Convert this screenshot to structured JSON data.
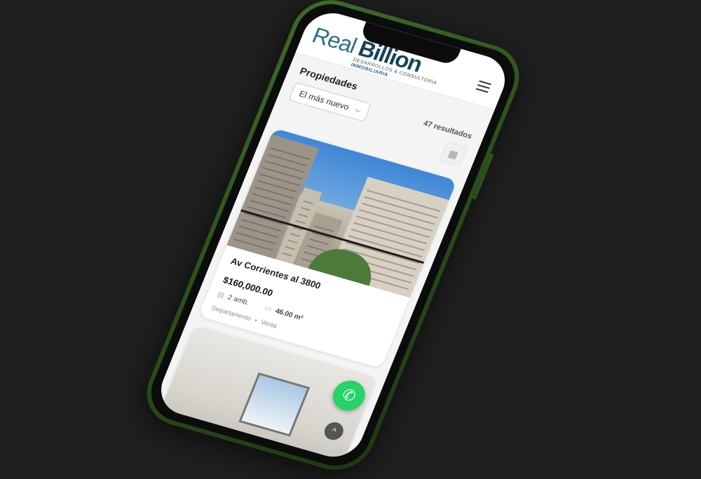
{
  "brand": {
    "name_part1": "Real",
    "name_part2": "Billion",
    "tagline": "DESARROLLOS & CONSULTORÍA",
    "tagline2": "INMOBILIARIA",
    "colors": {
      "primary": "#14425a",
      "accent": "#2a6f86",
      "frame": "#2b4f1d"
    }
  },
  "header": {
    "menu_icon": "hamburger-icon"
  },
  "list": {
    "title": "Propiedades",
    "sort_selected": "El más nuevo",
    "results": "47 resultados",
    "view_toggle_icon": "grid-icon"
  },
  "cards": [
    {
      "title": "Av Corrientes al 3800",
      "price": "$160,000.00",
      "rooms": "2 amb.",
      "area": "46.00 m²",
      "type": "Departamento",
      "operation": "Venta",
      "separator": "•"
    }
  ],
  "floating": {
    "whatsapp_icon": "whatsapp-icon",
    "whatsapp_glyph": "✆",
    "scroll_top_icon": "chevron-up-icon",
    "scroll_top_glyph": "^"
  }
}
